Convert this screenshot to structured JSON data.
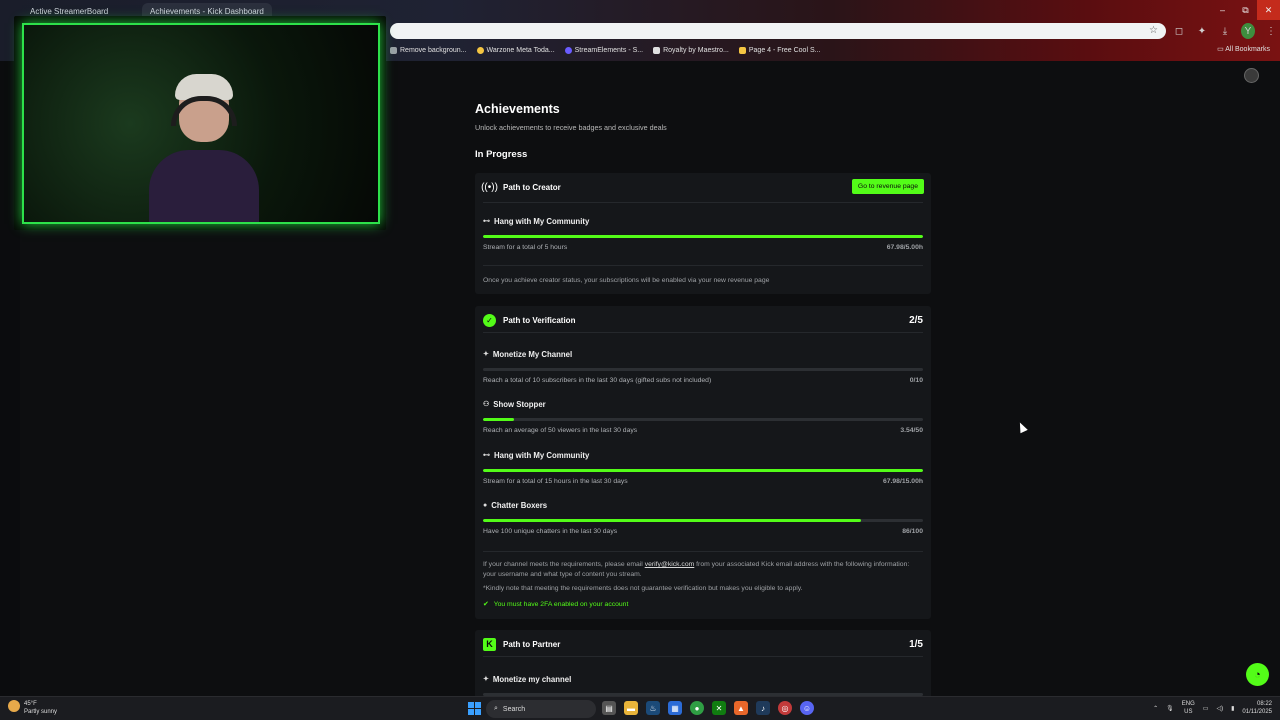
{
  "browser": {
    "tabs": [
      {
        "label": "Active StreamerBoard"
      },
      {
        "label": "Achievements - Kick Dashboard"
      }
    ],
    "window_controls": {
      "minimize": "–",
      "restore": "⧉",
      "close": "✕"
    },
    "bookmarks": [
      {
        "label": "Remove backgroun...",
        "color": "#9aa0a6"
      },
      {
        "label": "Warzone Meta Toda...",
        "color": "#f4c542"
      },
      {
        "label": "StreamElements - S...",
        "color": "#6a5cff"
      },
      {
        "label": "Royalty by Maestro...",
        "color": "#e0e0e0"
      },
      {
        "label": "Page 4 - Free Cool S...",
        "color": "#f4c542"
      }
    ],
    "all_bookmarks": "All Bookmarks"
  },
  "page": {
    "title": "Achievements",
    "subtitle": "Unlock achievements to receive badges and exclusive deals",
    "section": "In Progress"
  },
  "creator": {
    "title": "Path to Creator",
    "button": "Go to revenue page",
    "achievement": {
      "name": "Hang with My Community",
      "desc": "Stream for a total of 5 hours",
      "value": "67.98/5.00h",
      "progress": 1.0
    },
    "note": "Once you achieve creator status, your subscriptions will be enabled via your new revenue page"
  },
  "verification": {
    "title": "Path to Verification",
    "count": "2/5",
    "achievements": [
      {
        "name": "Monetize My Channel",
        "desc": "Reach a total of 10 subscribers in the last 30 days (gifted subs not included)",
        "value": "0/10",
        "progress": 0.0
      },
      {
        "name": "Show Stopper",
        "desc": "Reach an average of 50 viewers in the last 30 days",
        "value": "3.54/50",
        "progress": 0.0708
      },
      {
        "name": "Hang with My Community",
        "desc": "Stream for a total of 15 hours in the last 30 days",
        "value": "67.98/15.00h",
        "progress": 1.0
      },
      {
        "name": "Chatter Boxers",
        "desc": "Have 100 unique chatters in the last 30 days",
        "value": "86/100",
        "progress": 0.86
      }
    ],
    "note_pre": "If your channel meets the requirements, please email ",
    "email": "verify@kick.com",
    "note_post": " from your associated Kick email address with the following information: your username and what type of content you stream.",
    "disclaimer": "*Kindly note that meeting the requirements does not guarantee verification but makes you eligible to apply.",
    "twofa": "You must have 2FA enabled on your account"
  },
  "partner": {
    "title": "Path to Partner",
    "count": "1/5",
    "first": "Monetize my channel"
  },
  "taskbar": {
    "temp": "45°F",
    "weather": "Partly sunny",
    "search": "Search",
    "lang1": "ENG",
    "lang2": "US",
    "time": "08:22",
    "date": "01/11/2025"
  }
}
